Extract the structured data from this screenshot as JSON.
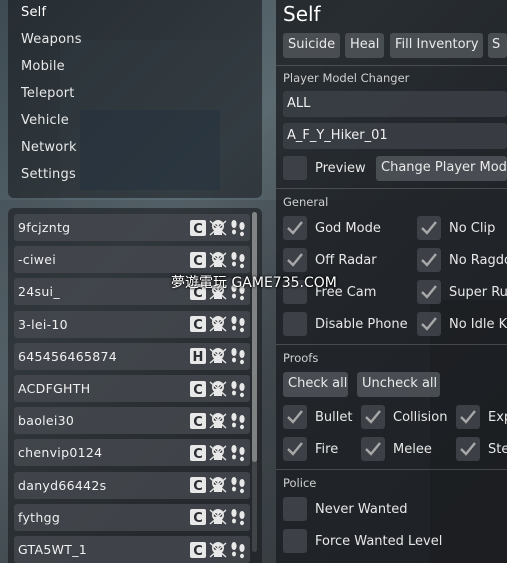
{
  "nav": {
    "items": [
      {
        "label": "Self"
      },
      {
        "label": "Weapons"
      },
      {
        "label": "Mobile"
      },
      {
        "label": "Teleport"
      },
      {
        "label": "Vehicle"
      },
      {
        "label": "Network"
      },
      {
        "label": "Settings"
      }
    ]
  },
  "players": [
    {
      "name": "9fcjzntg",
      "badge": "C"
    },
    {
      "name": "-ciwei",
      "badge": "C"
    },
    {
      "name": "24sui_",
      "badge": "C"
    },
    {
      "name": "3-lei-10",
      "badge": "C"
    },
    {
      "name": "645456465874",
      "badge": "H"
    },
    {
      "name": "ACDFGHTH",
      "badge": "C"
    },
    {
      "name": "baolei30",
      "badge": "C"
    },
    {
      "name": "chenvip0124",
      "badge": "C"
    },
    {
      "name": "danyd66442s",
      "badge": "C"
    },
    {
      "name": "fythgg",
      "badge": "C"
    },
    {
      "name": "GTA5WT_1",
      "badge": "C"
    }
  ],
  "panel": {
    "title": "Self",
    "actions": [
      "Suicide",
      "Heal",
      "Fill Inventory",
      "S"
    ],
    "model_changer": {
      "header": "Player Model Changer",
      "category": "ALL",
      "model": "A_F_Y_Hiker_01",
      "preview_label": "Preview",
      "change_button": "Change Player Mode"
    },
    "general": {
      "header": "General",
      "options": [
        {
          "label": "God Mode",
          "checked": true
        },
        {
          "label": "No Clip",
          "checked": true
        },
        {
          "label": "Off Radar",
          "checked": true
        },
        {
          "label": "No Ragdo",
          "checked": true
        },
        {
          "label": "Free Cam",
          "checked": false
        },
        {
          "label": "Super Ru",
          "checked": true
        },
        {
          "label": "Disable Phone",
          "checked": false
        },
        {
          "label": "No Idle Ki",
          "checked": true
        }
      ]
    },
    "proofs": {
      "header": "Proofs",
      "check_all": "Check all",
      "uncheck_all": "Uncheck all",
      "options": [
        {
          "label": "Bullet",
          "checked": true
        },
        {
          "label": "Collision",
          "checked": true
        },
        {
          "label": "Exp",
          "checked": true
        },
        {
          "label": "Fire",
          "checked": true
        },
        {
          "label": "Melee",
          "checked": true
        },
        {
          "label": "Ste",
          "checked": true
        }
      ]
    },
    "police": {
      "header": "Police",
      "options": [
        {
          "label": "Never Wanted",
          "checked": false
        },
        {
          "label": "Force Wanted Level",
          "checked": false
        }
      ]
    }
  },
  "watermark": "夢遊電玩 GAME735.COM",
  "colors": {
    "panel": "#1a1c20",
    "button": "#4e5258",
    "check": "#a8a8a8"
  }
}
